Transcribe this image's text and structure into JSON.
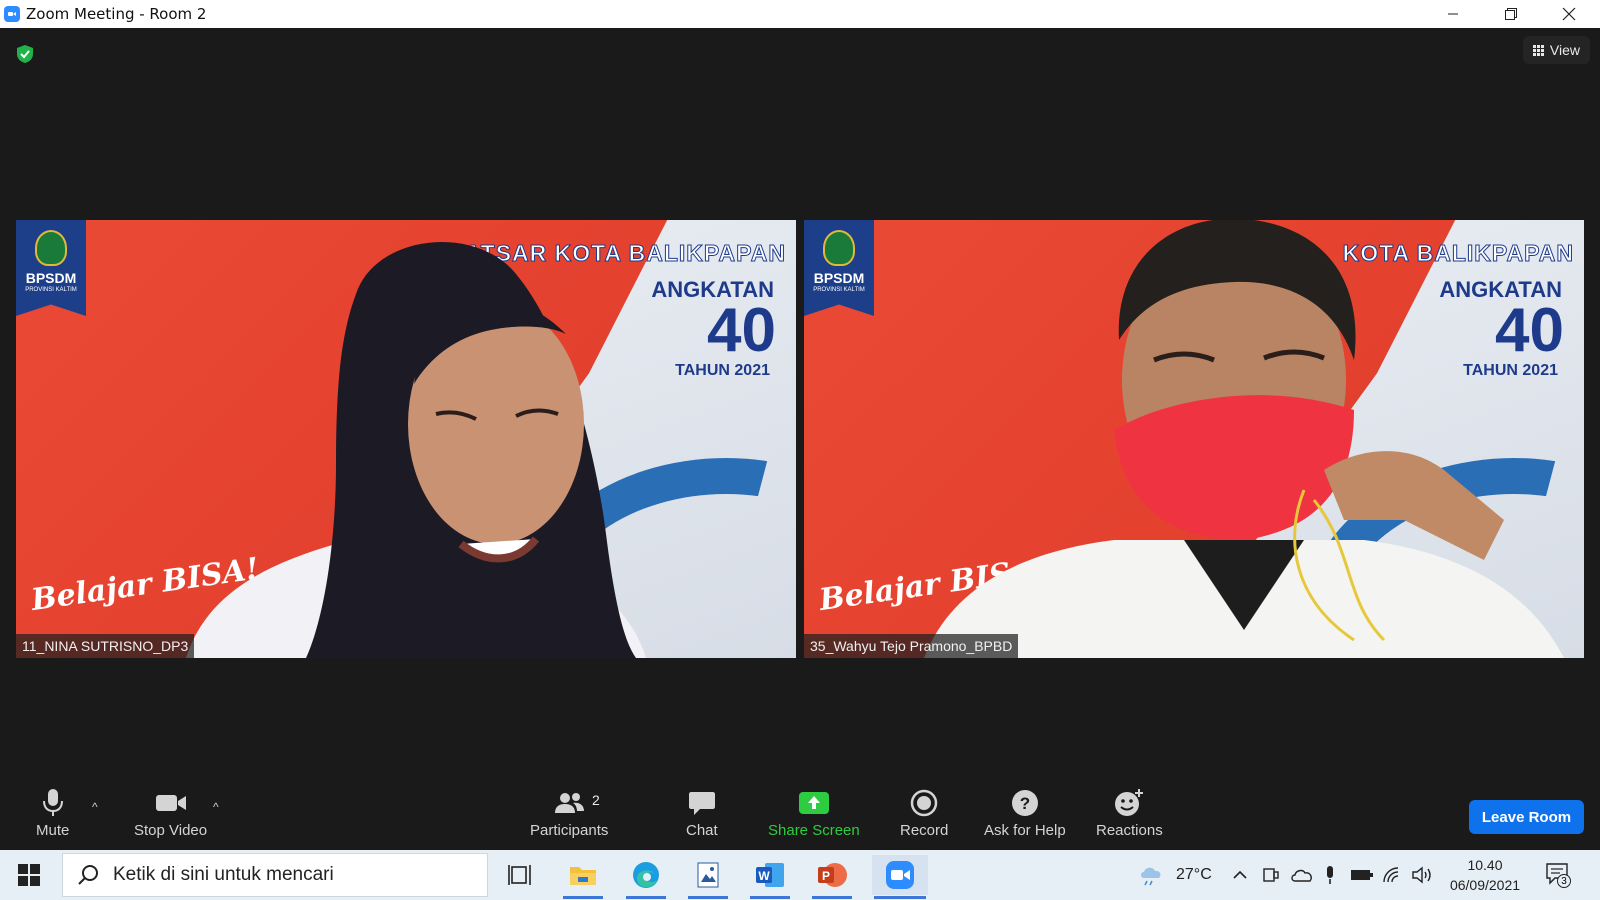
{
  "window": {
    "title": "Zoom Meeting - Room 2"
  },
  "top_bar": {
    "view_label": "View"
  },
  "tiles": [
    {
      "name_tag": "11_NINA SUTRISNO_DP3",
      "banner": {
        "line1": "LATSAR KOTA BALIKPAPAN",
        "line2": "ANGKATAN",
        "line3": "40",
        "line4": "TAHUN 2021"
      },
      "logo": {
        "name": "BPSDM",
        "sub": "PROVINSI KALTIM"
      },
      "slogan": "Belajar BISA!"
    },
    {
      "name_tag": "35_Wahyu Tejo Pramono_BPBD",
      "banner": {
        "line1": "KOTA BALIKPAPAN",
        "line2": "ANGKATAN",
        "line3": "40",
        "line4": "TAHUN 2021"
      },
      "logo": {
        "name": "BPSDM",
        "sub": "PROVINSI KALTIM"
      },
      "slogan": "Belajar BIS"
    }
  ],
  "toolbar": {
    "mute": "Mute",
    "stop_video": "Stop Video",
    "participants": "Participants",
    "participants_count": "2",
    "chat": "Chat",
    "share_screen": "Share Screen",
    "record": "Record",
    "ask_for_help": "Ask for Help",
    "reactions": "Reactions",
    "leave": "Leave Room"
  },
  "taskbar": {
    "search_placeholder": "Ketik di sini untuk mencari",
    "weather": "27°C",
    "time": "10.40",
    "date": "06/09/2021",
    "notification_count": "3"
  },
  "colors": {
    "share_green": "#2ecc40",
    "leave_blue": "#0e72ed",
    "shield_green": "#1fb34a"
  }
}
